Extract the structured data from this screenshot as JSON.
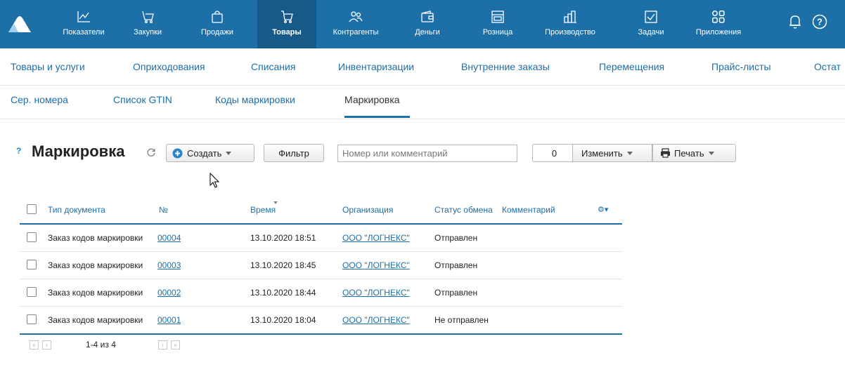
{
  "topnav": {
    "items": [
      {
        "label": "Показатели",
        "icon": "chart-line-icon"
      },
      {
        "label": "Закупки",
        "icon": "purchases-icon"
      },
      {
        "label": "Продажи",
        "icon": "shopping-bag-icon"
      },
      {
        "label": "Товары",
        "icon": "cart-icon",
        "active": true
      },
      {
        "label": "Контрагенты",
        "icon": "contacts-icon"
      },
      {
        "label": "Деньги",
        "icon": "wallet-icon"
      },
      {
        "label": "Розница",
        "icon": "store-icon"
      },
      {
        "label": "Производство",
        "icon": "factory-icon"
      },
      {
        "label": "Задачи",
        "icon": "task-check-icon"
      },
      {
        "label": "Приложения",
        "icon": "apps-icon"
      }
    ],
    "bell_icon": "bell-icon",
    "help_icon": "help-icon",
    "accent": "#1d6fa8"
  },
  "subnav": {
    "row1": [
      "Товары и услуги",
      "Оприходования",
      "Списания",
      "Инвентаризации",
      "Внутренние заказы",
      "Перемещения",
      "Прайс-листы",
      "Остат"
    ],
    "row2": [
      "Сер. номера",
      "Список GTIN",
      "Коды маркировки",
      "Маркировка"
    ],
    "active": "Маркировка"
  },
  "toolbar": {
    "help_mark": "?",
    "title": "Маркировка",
    "create_label": "Создать",
    "filter_label": "Фильтр",
    "search_placeholder": "Номер или комментарий",
    "counter": "0",
    "change_label": "Изменить",
    "print_label": "Печать"
  },
  "table": {
    "headers": [
      "Тип документа",
      "№",
      "Время",
      "Организация",
      "Статус обмена",
      "Комментарий"
    ],
    "rows": [
      {
        "type": "Заказ кодов маркировки",
        "number": "00004",
        "time": "13.10.2020 18:51",
        "org": "ООО \"ЛОГНЕКС\"",
        "status": "Отправлен",
        "comment": ""
      },
      {
        "type": "Заказ кодов маркировки",
        "number": "00003",
        "time": "13.10.2020 18:45",
        "org": "ООО \"ЛОГНЕКС\"",
        "status": "Отправлен",
        "comment": ""
      },
      {
        "type": "Заказ кодов маркировки",
        "number": "00002",
        "time": "13.10.2020 18:44",
        "org": "ООО \"ЛОГНЕКС\"",
        "status": "Отправлен",
        "comment": ""
      },
      {
        "type": "Заказ кодов маркировки",
        "number": "00001",
        "time": "13.10.2020 18:04",
        "org": "ООО \"ЛОГНЕКС\"",
        "status": "Не отправлен",
        "comment": ""
      }
    ]
  },
  "pager": {
    "text": "1-4 из 4",
    "first": "«",
    "prev": "‹",
    "next": "›",
    "last": "»"
  }
}
